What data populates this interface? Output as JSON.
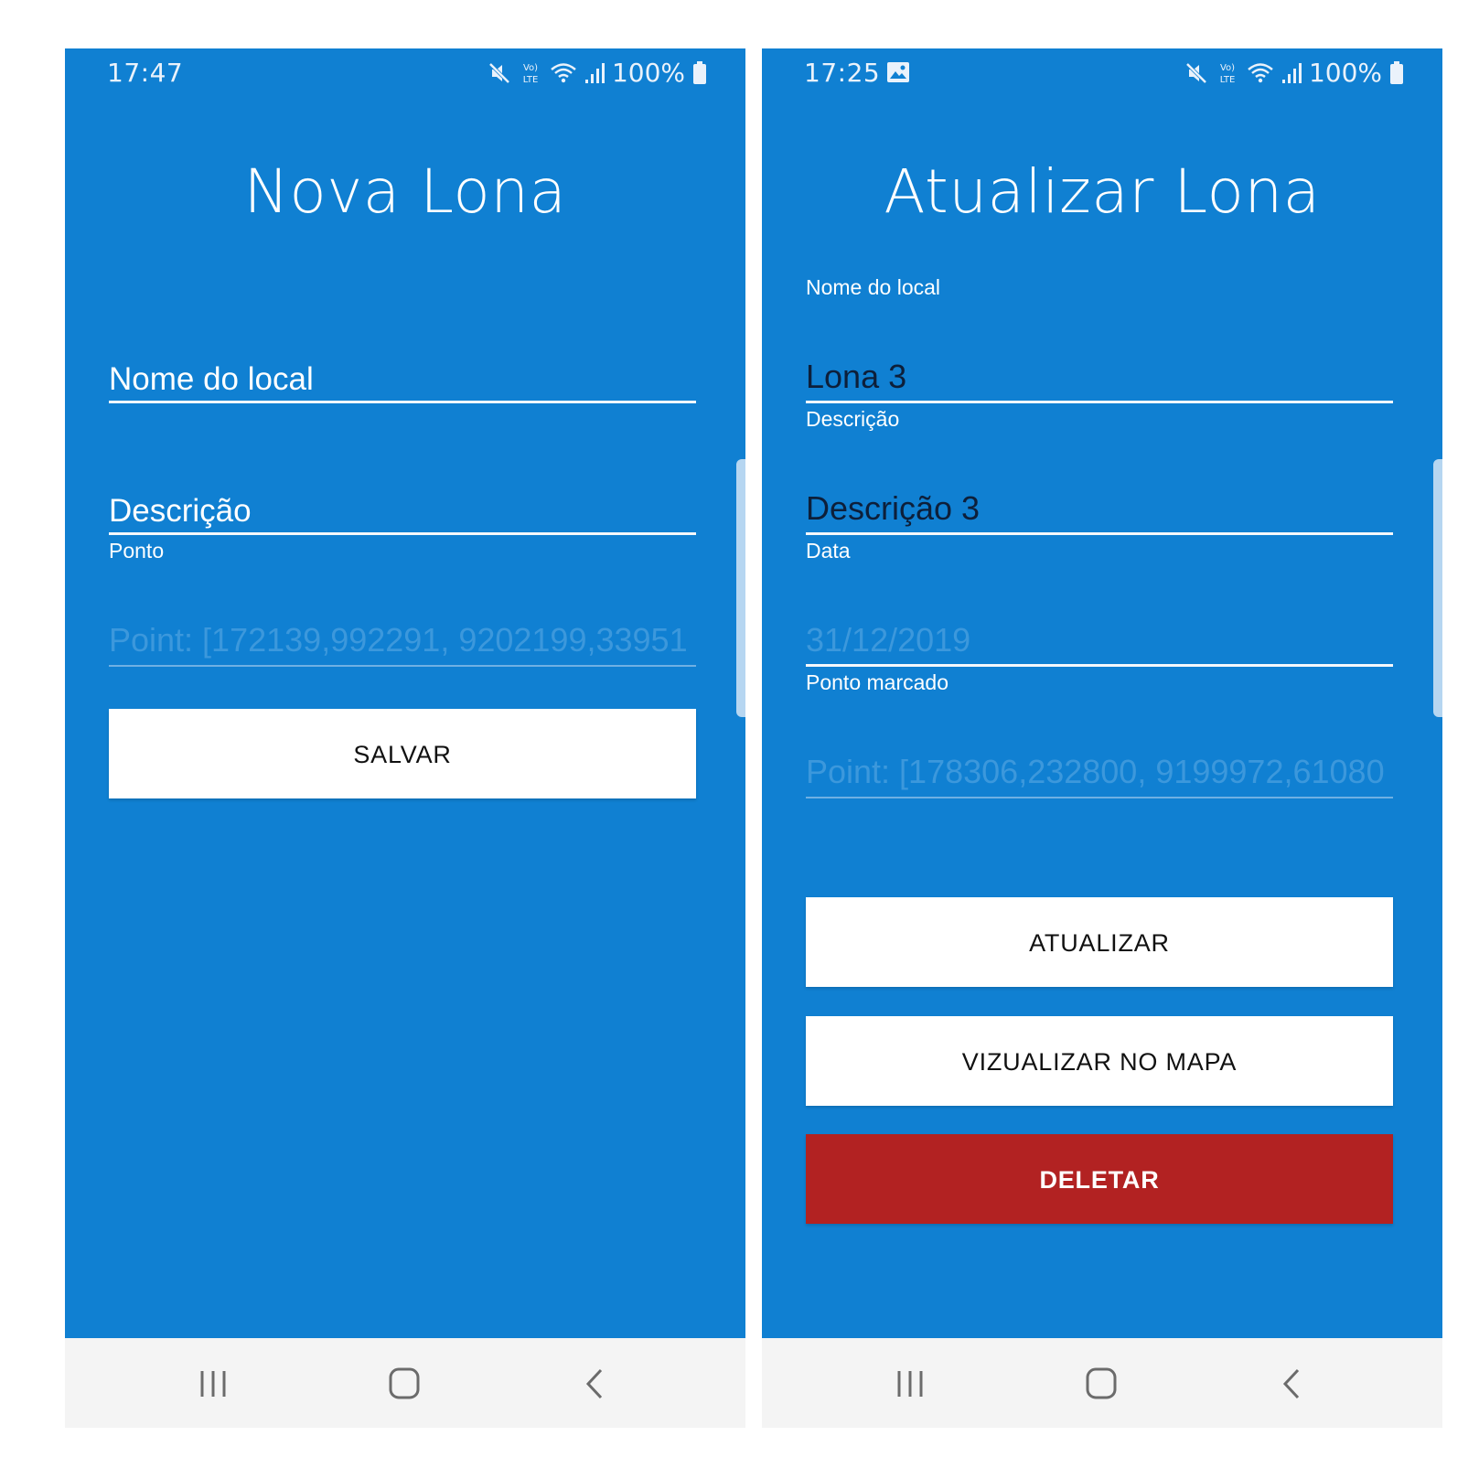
{
  "colors": {
    "background": "#1080d2",
    "button": "#ffffff",
    "danger": "#b22222",
    "navbar": "#f4f4f4"
  },
  "left_screen": {
    "status_bar": {
      "time": "17:47",
      "battery": "100%",
      "icons": [
        "mute-icon",
        "volte-icon",
        "wifi-icon",
        "signal-icon",
        "battery-icon"
      ]
    },
    "title": "Nova Lona",
    "fields": {
      "nome_placeholder": "Nome do local",
      "descricao_placeholder": "Descrição",
      "ponto_label": "Ponto",
      "ponto_value": "Point: [172139,992291, 9202199,33951"
    },
    "buttons": {
      "salvar": "SALVAR"
    },
    "nav": [
      "recents-icon",
      "home-icon",
      "back-icon"
    ]
  },
  "right_screen": {
    "status_bar": {
      "time": "17:25",
      "battery": "100%",
      "icons": [
        "gallery-icon",
        "mute-icon",
        "volte-icon",
        "wifi-icon",
        "signal-icon",
        "battery-icon"
      ]
    },
    "title": "Atualizar Lona",
    "fields": {
      "nome_label": "Nome do local",
      "nome_value": "Lona 3",
      "descricao_label": "Descrição",
      "descricao_value": "Descrição 3",
      "data_label": "Data",
      "data_value": "31/12/2019",
      "ponto_label": "Ponto marcado",
      "ponto_value": "Point: [178306,232800, 9199972,61080"
    },
    "buttons": {
      "atualizar": "ATUALIZAR",
      "visualizar": "VIZUALIZAR NO MAPA",
      "deletar": "DELETAR"
    },
    "nav": [
      "recents-icon",
      "home-icon",
      "back-icon"
    ]
  }
}
